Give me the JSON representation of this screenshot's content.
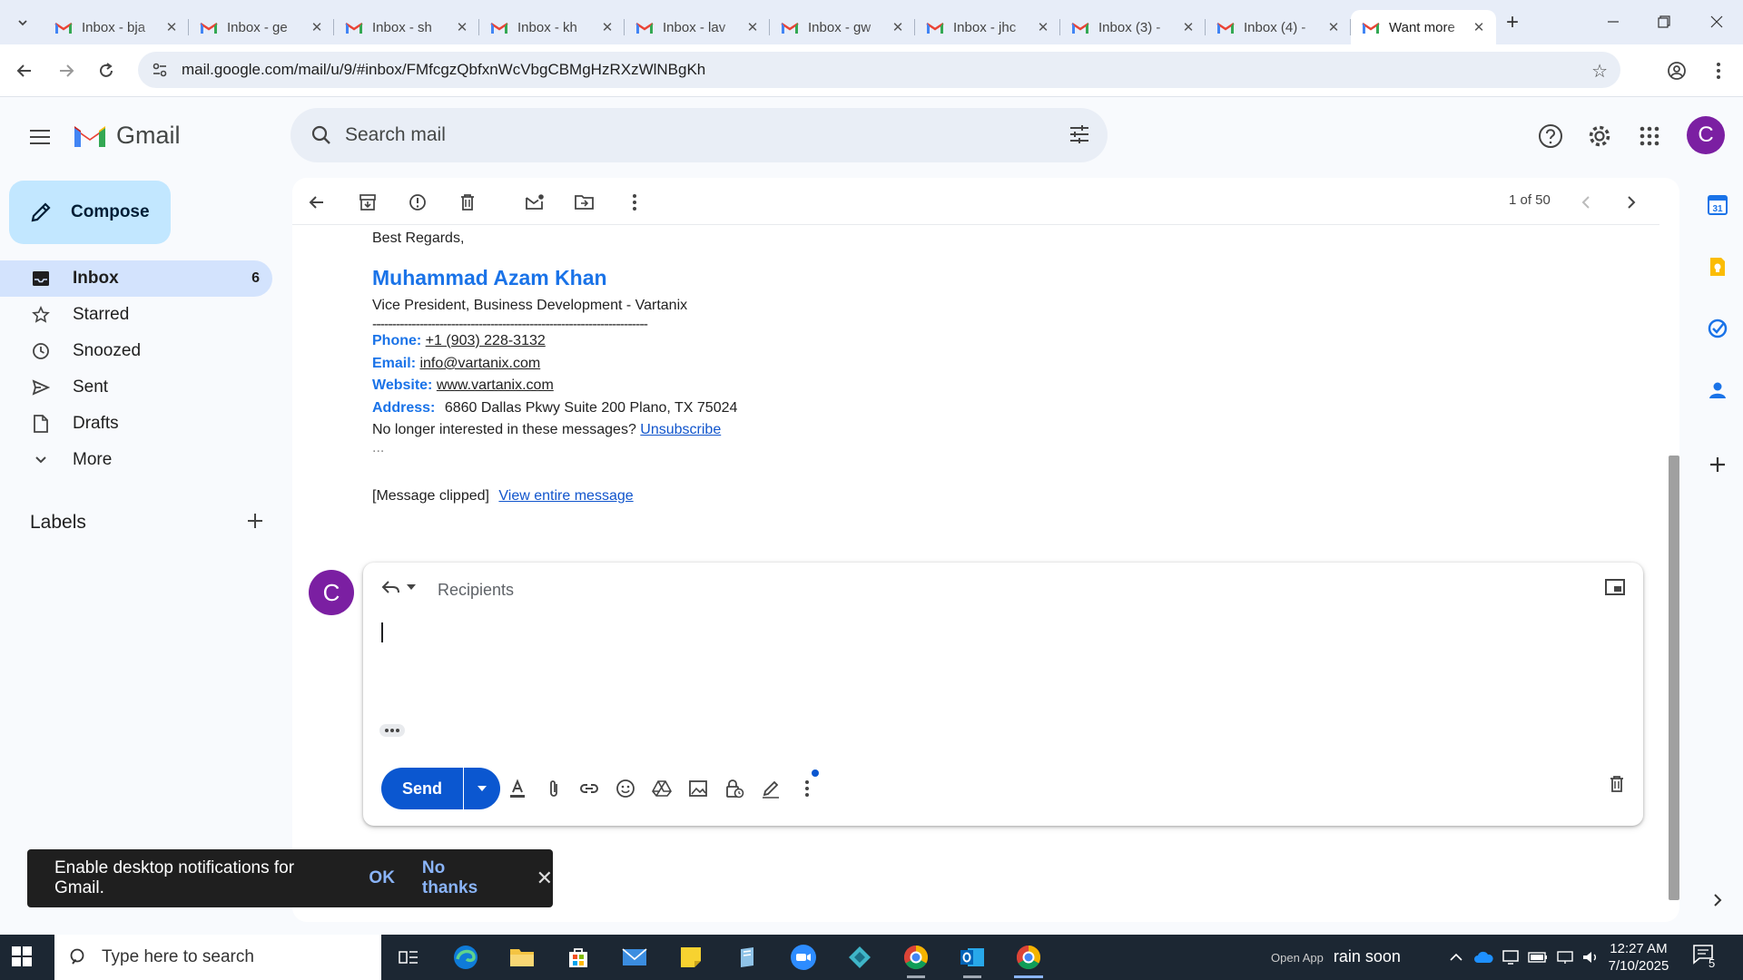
{
  "browser": {
    "tabs": [
      {
        "title": "Inbox - bja",
        "active": false
      },
      {
        "title": "Inbox - ge",
        "active": false
      },
      {
        "title": "Inbox - sh",
        "active": false
      },
      {
        "title": "Inbox - kh",
        "active": false
      },
      {
        "title": "Inbox - lav",
        "active": false
      },
      {
        "title": "Inbox - gw",
        "active": false
      },
      {
        "title": "Inbox - jhc",
        "active": false
      },
      {
        "title": "Inbox (3) -",
        "active": false
      },
      {
        "title": "Inbox (4) -",
        "active": false
      },
      {
        "title": "Want more",
        "active": true
      }
    ],
    "url": "mail.google.com/mail/u/9/#inbox/FMfcgzQbfxnWcVbgCBMgHzRXzWlNBgKh"
  },
  "gmail": {
    "logo_text": "Gmail",
    "search_placeholder": "Search mail",
    "compose_label": "Compose",
    "nav": [
      {
        "label": "Inbox",
        "count": "6",
        "icon": "inbox-icon",
        "active": true
      },
      {
        "label": "Starred",
        "count": "",
        "icon": "star-icon",
        "active": false
      },
      {
        "label": "Snoozed",
        "count": "",
        "icon": "clock-icon",
        "active": false
      },
      {
        "label": "Sent",
        "count": "",
        "icon": "send-icon",
        "active": false
      },
      {
        "label": "Drafts",
        "count": "",
        "icon": "draft-icon",
        "active": false
      },
      {
        "label": "More",
        "count": "",
        "icon": "chevron-down-icon",
        "active": false
      }
    ],
    "labels_heading": "Labels",
    "avatar_letter": "C",
    "pager": "1 of 50"
  },
  "message": {
    "closing": "Best Regards,",
    "sig_name": "Muhammad Azam Khan",
    "sig_title": "Vice President, Business Development - Vartanix",
    "divider": "----------------------------------------------------------------------",
    "phone_label": "Phone:",
    "phone": " +1 (903) 228-3132",
    "email_label": "Email:",
    "email": " info@vartanix.com",
    "website_label": "Website:",
    "website": " www.vartanix.com",
    "address_label": "Address:",
    "address": "6860 Dallas Pkwy Suite 200 Plano, TX 75024",
    "unsub_text": "No longer interested in these messages?",
    "unsub_link": "Unsubscribe",
    "ellipsis": "...",
    "clipped_text": "[Message clipped]",
    "view_entire": "View entire message"
  },
  "reply": {
    "recipients_placeholder": "Recipients",
    "send_label": "Send"
  },
  "toast": {
    "message": "Enable desktop notifications for Gmail.",
    "ok": "OK",
    "no_thanks": "No thanks"
  },
  "taskbar": {
    "search_placeholder": "Type here to search",
    "weather_text": "rain soon",
    "weather_small": "Open App",
    "time": "12:27 AM",
    "date": "7/10/2025",
    "notification_count": "5"
  },
  "colors": {
    "gmail_blue": "#0b57d0",
    "sig_blue": "#1a73e8",
    "compose_bg": "#c2e7ff",
    "nav_active_bg": "#d3e3fd",
    "avatar_purple": "#7b1fa2"
  }
}
